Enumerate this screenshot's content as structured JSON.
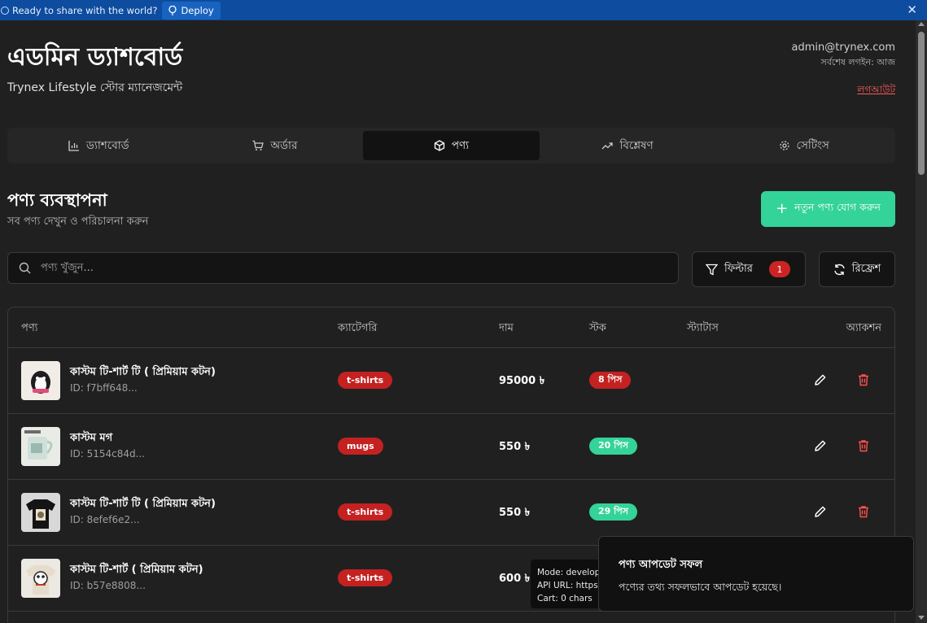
{
  "deploy_bar": {
    "text": "Ready to share with the world?",
    "button_label": "Deploy",
    "close": "✕"
  },
  "header": {
    "title": "এডমিন ড্যাশবোর্ড",
    "subtitle": "Trynex Lifestyle স্টোর ম্যানেজমেন্ট",
    "admin_email": "admin@trynex.com",
    "last_login": "সর্বশেষ লগইন: আজ",
    "logout": "লগআউট"
  },
  "tabs": [
    {
      "label": "ড্যাশবোর্ড",
      "icon": "bar-chart-icon",
      "active": false
    },
    {
      "label": "অর্ডার",
      "icon": "cart-icon",
      "active": false
    },
    {
      "label": "পণ্য",
      "icon": "package-icon",
      "active": true
    },
    {
      "label": "বিশ্লেষণ",
      "icon": "trending-up-icon",
      "active": false
    },
    {
      "label": "সেটিংস",
      "icon": "gear-icon",
      "active": false
    }
  ],
  "products_section": {
    "title": "পণ্য ব্যবস্থাপনা",
    "subtitle": "সব পণ্য দেখুন ও পরিচালনা করুন",
    "add_button": "নতুন পণ্য যোগ করুন",
    "search_placeholder": "পণ্য খুঁজুন...",
    "filter_label": "ফিল্টার",
    "filter_count": "1",
    "refresh_label": "রিফ্রেশ"
  },
  "table": {
    "columns": {
      "product": "পণ্য",
      "category": "ক্যাটেগরি",
      "price": "দাম",
      "stock": "স্টক",
      "status": "স্ট্যাটাস",
      "action": "অ্যাকশন"
    },
    "rows": [
      {
        "name": "কাস্টম টি-শার্ট টি ( প্রিমিয়াম কটন)",
        "id": "ID: f7bff648...",
        "category": "t-shirts",
        "price": "95000 ৳",
        "stock": "8 পিস",
        "stock_level": "low"
      },
      {
        "name": "কাস্টম মগ",
        "id": "ID: 5154c84d...",
        "category": "mugs",
        "price": "550 ৳",
        "stock": "20 পিস",
        "stock_level": "ok"
      },
      {
        "name": "কাস্টম টি-শার্ট টি ( প্রিমিয়াম কটন)",
        "id": "ID: 8efef6e2...",
        "category": "t-shirts",
        "price": "550 ৳",
        "stock": "29 পিস",
        "stock_level": "ok"
      },
      {
        "name": "কাস্টম টি-শার্ট ( প্রিমিয়াম কটন)",
        "id": "ID: b57e8808...",
        "category": "t-shirts",
        "price": "600 ৳",
        "stock": "",
        "stock_level": "hidden"
      }
    ]
  },
  "dev_tooltip": {
    "mode": "Mode: develop",
    "api": "API URL: https:",
    "cart": "Cart: 0 chars"
  },
  "toast": {
    "title": "পণ্য আপডেট সফল",
    "message": "পণ্যের তথ্য সফলভাবে আপডেট হয়েছে।"
  },
  "colors": {
    "accent_green": "#34d399",
    "danger_red": "#c42121",
    "deploy_blue": "#0d4c9e"
  }
}
